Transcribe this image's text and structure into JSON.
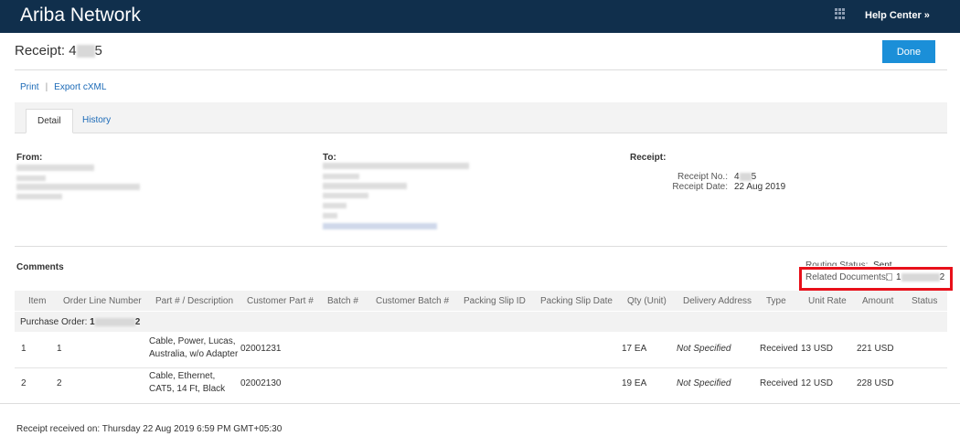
{
  "app": {
    "brand": "Ariba Network",
    "help_center": "Help Center »"
  },
  "page": {
    "title_prefix": "Receipt: 4",
    "title_suffix": "5",
    "done_label": "Done"
  },
  "actions": {
    "print": "Print",
    "separator": "|",
    "export": "Export cXML"
  },
  "tabs": [
    {
      "label": "Detail"
    },
    {
      "label": "History"
    }
  ],
  "parties": {
    "from_label": "From:",
    "to_label": "To:",
    "receipt_label": "Receipt:"
  },
  "receipt": {
    "no_label": "Receipt No.:",
    "no_prefix": "4",
    "no_suffix": "5",
    "date_label": "Receipt Date:",
    "date_value": "22 Aug 2019"
  },
  "comments_label": "Comments",
  "routing": {
    "label": "Routing Status:",
    "value": "Sent"
  },
  "related": {
    "label": "Related Documents:",
    "prefix": "1",
    "suffix": "2"
  },
  "table": {
    "headers": [
      "Item",
      "Order Line Number",
      "Part # / Description",
      "Customer Part #",
      "Batch #",
      "Customer Batch #",
      "Packing Slip ID",
      "Packing Slip Date",
      "Qty (Unit)",
      "Delivery Address",
      "Type",
      "Unit Rate",
      "Amount",
      "Status"
    ],
    "po_prefix": "Purchase Order: ",
    "po_start": "1",
    "po_end": "2",
    "rows": [
      {
        "item": "1",
        "line": "1",
        "desc1": "Cable, Power, Lucas,",
        "desc2": "Australia, w/o Adapter",
        "cust_part": "02001231",
        "qty": "17 EA",
        "delivery": "Not Specified",
        "type": "Received",
        "rate": "13 USD",
        "amount": "221 USD"
      },
      {
        "item": "2",
        "line": "2",
        "desc1": "Cable, Ethernet,",
        "desc2": "CAT5, 14 Ft, Black",
        "cust_part": "02002130",
        "qty": "19 EA",
        "delivery": "Not Specified",
        "type": "Received",
        "rate": "12 USD",
        "amount": "228 USD"
      }
    ]
  },
  "footer": "Receipt received on: Thursday 22 Aug 2019 6:59 PM GMT+05:30"
}
